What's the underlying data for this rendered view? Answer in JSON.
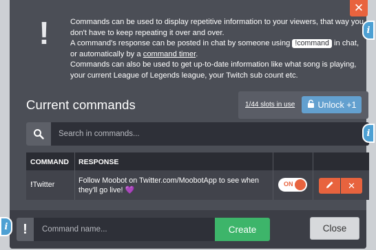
{
  "description": {
    "line1": "Commands can be used to display repetitive information to your viewers, that way you don't have to keep repeating it over and over.",
    "line2_pre": "A command's response can be posted in chat by someone using",
    "line2_chip": "!command",
    "line2_post": "in chat, or automatically by a",
    "line2_link": "command timer",
    "line2_end": ".",
    "line3": "Commands can also be used to get up-to-date information like what song is playing, your current League of Legends league, your Twitch sub count etc."
  },
  "header": {
    "title": "Current commands",
    "slots_text": "1/44 slots in use",
    "unlock_label": "Unlock +1"
  },
  "search": {
    "placeholder": "Search in commands..."
  },
  "table": {
    "columns": [
      "COMMAND",
      "RESPONSE"
    ],
    "rows": [
      {
        "command_prefix": "!",
        "command": "Twitter",
        "response": "Follow Moobot on Twitter.com/MoobotApp to see when they'll go live!",
        "toggle_label": "ON"
      }
    ]
  },
  "footer": {
    "bang": "!",
    "input_placeholder": "Command name...",
    "create_label": "Create",
    "close_label": "Close"
  },
  "icons": {
    "close": "close-icon",
    "info": "info-icon",
    "search": "search-icon",
    "lock": "lock-icon",
    "edit": "pencil-icon",
    "delete": "close-icon"
  },
  "colors": {
    "accent_orange": "#e8633e",
    "accent_blue": "#63a0cf",
    "create_green": "#3db56a",
    "panel_bg": "#4b4e56"
  }
}
